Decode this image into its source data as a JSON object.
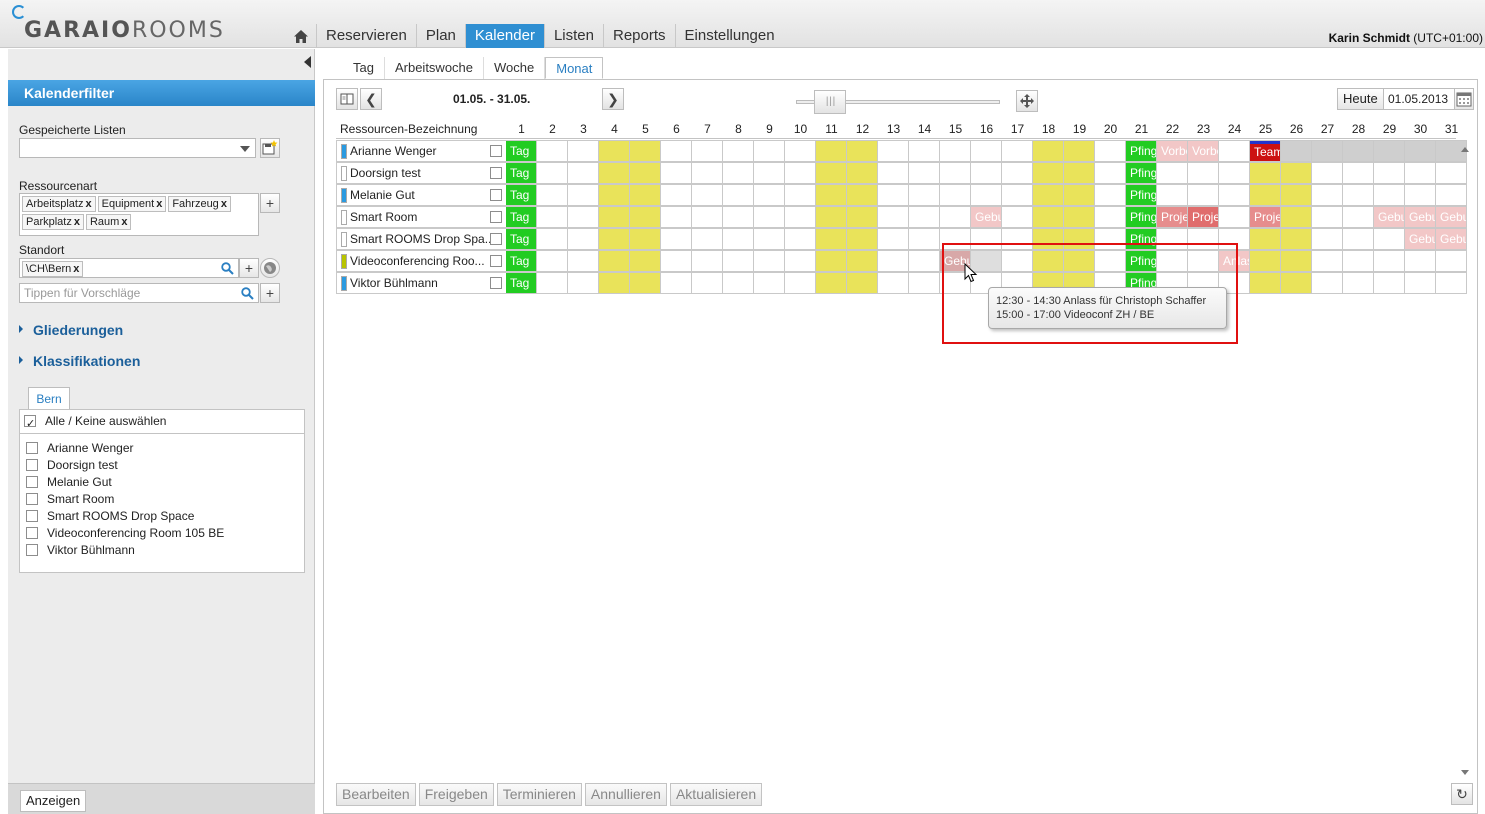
{
  "app": {
    "logo_text_bold": "GARAIO",
    "logo_text_light": "ROOMS"
  },
  "nav": {
    "home_icon": "home-icon",
    "items": [
      {
        "label": "Reservieren",
        "active": false
      },
      {
        "label": "Plan",
        "active": false
      },
      {
        "label": "Kalender",
        "active": true
      },
      {
        "label": "Listen",
        "active": false
      },
      {
        "label": "Reports",
        "active": false
      },
      {
        "label": "Einstellungen",
        "active": false
      }
    ]
  },
  "user": {
    "name": "Karin Schmidt",
    "timezone": "(UTC+01:00)"
  },
  "sidebar": {
    "title": "Kalenderfilter",
    "saved_lists_label": "Gespeicherte Listen",
    "saved_lists_value": "",
    "resource_type_label": "Ressourcenart",
    "resource_types": [
      "Arbeitsplatz",
      "Equipment",
      "Fahrzeug",
      "Parkplatz",
      "Raum"
    ],
    "location_label": "Standort",
    "location_chip": "\\CH\\Bern",
    "suggest_placeholder": "Tippen für Vorschläge",
    "section_gliederungen": "Gliederungen",
    "section_klassifikationen": "Klassifikationen",
    "group_tab": "Bern",
    "select_all_label": "Alle / Keine auswählen",
    "select_all_checked": true,
    "resources": [
      "Arianne Wenger",
      "Doorsign test",
      "Melanie Gut",
      "Smart Room",
      "Smart ROOMS Drop Space",
      "Videoconferencing Room 105 BE",
      "Viktor Bühlmann"
    ],
    "show_button": "Anzeigen"
  },
  "view_tabs": [
    {
      "label": "Tag",
      "active": false
    },
    {
      "label": "Arbeitswoche",
      "active": false
    },
    {
      "label": "Woche",
      "active": false
    },
    {
      "label": "Monat",
      "active": true
    }
  ],
  "toolbar": {
    "date_range": "01.05. - 31.05.",
    "today_label": "Heute",
    "date_value": "01.05.2013"
  },
  "calendar": {
    "header_label": "Ressourcen-Bezeichnung",
    "days": [
      1,
      2,
      3,
      4,
      5,
      6,
      7,
      8,
      9,
      10,
      11,
      12,
      13,
      14,
      15,
      16,
      17,
      18,
      19,
      20,
      21,
      22,
      23,
      24,
      25,
      26,
      27,
      28,
      29,
      30,
      31
    ],
    "weekend_days": [
      4,
      5,
      11,
      12,
      18,
      19,
      25,
      26
    ],
    "colors": {
      "weekend": "#e9e35a",
      "holiday_green": "#22cc22",
      "booking_pink": "#f2c7c7",
      "booking_rose": "#e68d8d",
      "booking_red": "#cc1111",
      "booking_brown": "#d8a8a8",
      "unavailable_gray": "#cfcfcf"
    },
    "rows": [
      {
        "name": "Arianne Wenger",
        "color": "#2a9ae0",
        "gray_days": [
          26,
          27,
          28,
          29,
          30,
          31
        ],
        "yellow_days": [
          25
        ],
        "events": [
          {
            "day": 1,
            "span": 1,
            "label": "Tag",
            "color": "#22cc22",
            "text_color": "#ffffff"
          },
          {
            "day": 21,
            "span": 1,
            "label": "Pfingstmontag",
            "color": "#22cc22",
            "text_color": "#ffffff"
          },
          {
            "day": 22,
            "span": 1,
            "label": "Vorbereitung",
            "color": "#f2c7c7",
            "text_color": "#ffffff"
          },
          {
            "day": 23,
            "span": 1,
            "label": "Vorbereitung",
            "color": "#f2c7c7",
            "text_color": "#ffffff"
          },
          {
            "day": 25,
            "span": 1,
            "label": "Team",
            "color": "#cc1111",
            "text_color": "#ffffff"
          }
        ]
      },
      {
        "name": "Doorsign test",
        "color": "#ffffff",
        "gray_days": [],
        "yellow_days": [],
        "events": [
          {
            "day": 1,
            "span": 1,
            "label": "Tag",
            "color": "#22cc22",
            "text_color": "#ffffff"
          },
          {
            "day": 21,
            "span": 1,
            "label": "Pfingstmontag",
            "color": "#22cc22",
            "text_color": "#ffffff"
          }
        ]
      },
      {
        "name": "Melanie Gut",
        "color": "#2a9ae0",
        "gray_days": [],
        "yellow_days": [],
        "events": [
          {
            "day": 1,
            "span": 1,
            "label": "Tag",
            "color": "#22cc22",
            "text_color": "#ffffff"
          },
          {
            "day": 21,
            "span": 1,
            "label": "Pfingstmontag",
            "color": "#22cc22",
            "text_color": "#ffffff"
          }
        ]
      },
      {
        "name": "Smart Room",
        "color": "#ffffff",
        "gray_days": [],
        "yellow_days": [],
        "events": [
          {
            "day": 1,
            "span": 1,
            "label": "Tag",
            "color": "#22cc22",
            "text_color": "#ffffff"
          },
          {
            "day": 16,
            "span": 1,
            "label": "Geburtstag",
            "color": "#f2c7c7",
            "text_color": "#ffffff"
          },
          {
            "day": 21,
            "span": 1,
            "label": "Pfingstmontag",
            "color": "#22cc22",
            "text_color": "#ffffff"
          },
          {
            "day": 22,
            "span": 1,
            "label": "Projekt",
            "color": "#e68d8d",
            "text_color": "#ffffff"
          },
          {
            "day": 23,
            "span": 1,
            "label": "Projekt",
            "color": "#e06d6d",
            "text_color": "#ffffff"
          },
          {
            "day": 25,
            "span": 1,
            "label": "Projekt",
            "color": "#e68d8d",
            "text_color": "#ffffff"
          },
          {
            "day": 29,
            "span": 1,
            "label": "Geburtstag",
            "color": "#f2c7c7",
            "text_color": "#ffffff"
          },
          {
            "day": 30,
            "span": 1,
            "label": "Geburtstag",
            "color": "#f2c7c7",
            "text_color": "#ffffff"
          },
          {
            "day": 31,
            "span": 1,
            "label": "Geburtstag",
            "color": "#f2c7c7",
            "text_color": "#ffffff"
          }
        ]
      },
      {
        "name": "Smart ROOMS Drop Spa...",
        "color": "#ffffff",
        "gray_days": [],
        "yellow_days": [],
        "events": [
          {
            "day": 1,
            "span": 1,
            "label": "Tag",
            "color": "#22cc22",
            "text_color": "#ffffff"
          },
          {
            "day": 21,
            "span": 1,
            "label": "Pfingstmontag",
            "color": "#22cc22",
            "text_color": "#ffffff"
          },
          {
            "day": 30,
            "span": 1,
            "label": "Geburtstag",
            "color": "#f2c7c7",
            "text_color": "#ffffff"
          },
          {
            "day": 31,
            "span": 1,
            "label": "Geburtstag",
            "color": "#f2c7c7",
            "text_color": "#ffffff"
          }
        ]
      },
      {
        "name": "Videoconferencing Roo...",
        "color": "#b8c400",
        "gray_days": [],
        "yellow_days": [],
        "events": [
          {
            "day": 1,
            "span": 1,
            "label": "Tag",
            "color": "#22cc22",
            "text_color": "#ffffff"
          },
          {
            "day": 15,
            "span": 1,
            "label": "Geburtstag",
            "color": "#d8a8a8",
            "text_color": "#ffffff"
          },
          {
            "day": 16,
            "span": 1,
            "label": "",
            "color": "#dedede",
            "text_color": "#ffffff"
          },
          {
            "day": 21,
            "span": 1,
            "label": "Pfingstmontag",
            "color": "#22cc22",
            "text_color": "#ffffff"
          },
          {
            "day": 24,
            "span": 1,
            "label": "Anlass",
            "color": "#f2c7c7",
            "text_color": "#ffffff"
          }
        ]
      },
      {
        "name": "Viktor Bühlmann",
        "color": "#2a9ae0",
        "gray_days": [],
        "yellow_days": [],
        "events": [
          {
            "day": 1,
            "span": 1,
            "label": "Tag",
            "color": "#22cc22",
            "text_color": "#ffffff"
          },
          {
            "day": 21,
            "span": 1,
            "label": "Pfingstmontag",
            "color": "#22cc22",
            "text_color": "#ffffff"
          }
        ]
      }
    ]
  },
  "tooltip": {
    "line1": "12:30 - 14:30 Anlass für Christoph Schaffer",
    "line2": "15:00 - 17:00 Videoconf ZH / BE"
  },
  "actions": {
    "edit": "Bearbeiten",
    "release": "Freigeben",
    "schedule": "Terminieren",
    "cancel": "Annullieren",
    "refresh": "Aktualisieren"
  }
}
